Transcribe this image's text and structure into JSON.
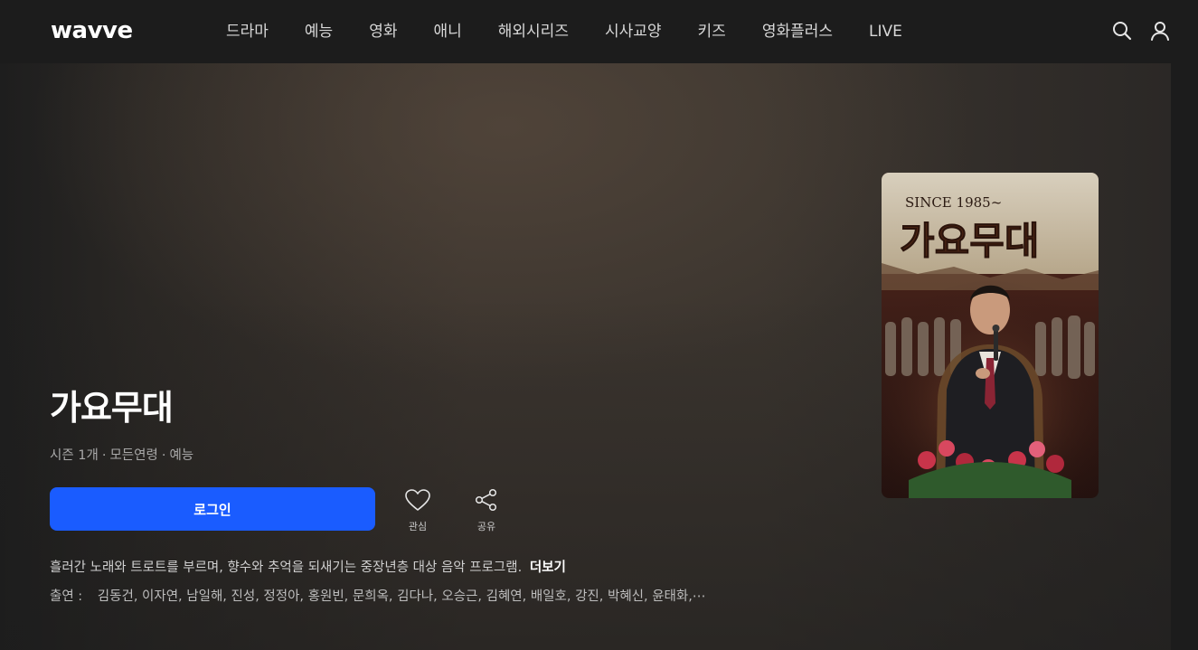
{
  "header": {
    "logo": "wavve",
    "nav": [
      "드라마",
      "예능",
      "영화",
      "애니",
      "해외시리즈",
      "시사교양",
      "키즈",
      "영화플러스",
      "LIVE"
    ],
    "icons": {
      "search": "search-icon",
      "profile": "user-icon"
    }
  },
  "program": {
    "title": "가요무대",
    "meta": [
      "시즌 1개",
      "모든연령",
      "예능"
    ],
    "login_label": "로그인",
    "favorite_label": "관심",
    "share_label": "공유",
    "description": "흘러간 노래와 트로트를 부르며, 향수와 추억을 되새기는 중장년층 대상 음악 프로그램.",
    "more_label": "더보기",
    "cast_label": "출연 :",
    "cast": "김동건, 이자연, 남일해, 진성, 정정아, 홍원빈, 문희옥, 김다나, 오승근, 김혜연, 배일호, 강진, 박혜신, 윤태화,⋯"
  },
  "poster": {
    "since_text": "SINCE 1985~",
    "logo_text": "가요무대"
  },
  "colors": {
    "background": "#1c1c1c",
    "accent": "#1a5cff",
    "text_secondary": "#a9a9a9"
  }
}
